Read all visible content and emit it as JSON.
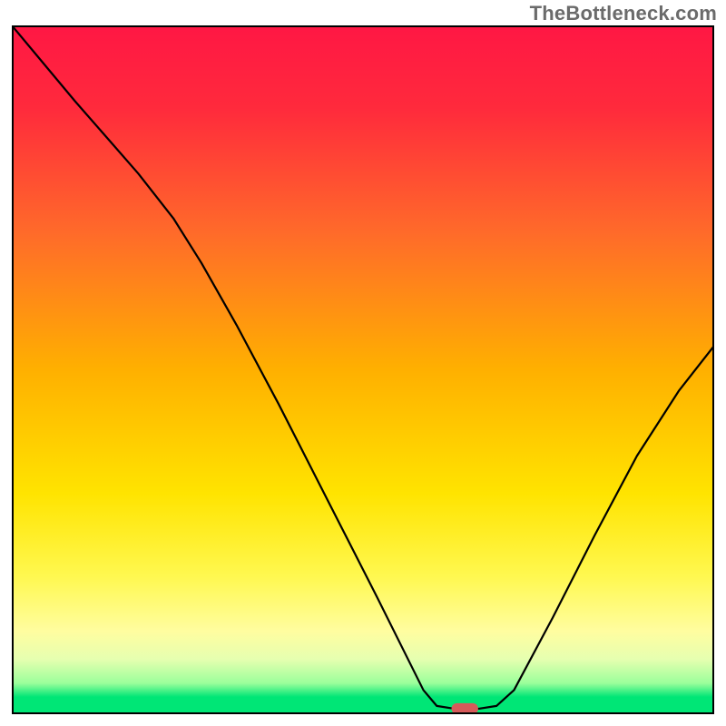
{
  "watermark": "TheBottleneck.com",
  "chart_data": {
    "type": "line",
    "title": "",
    "xlabel": "",
    "ylabel": "",
    "xlim": [
      0,
      100
    ],
    "ylim": [
      0,
      100
    ],
    "grid": false,
    "axes_visible": false,
    "gradient_stops": [
      {
        "offset": 0.0,
        "color": "#ff1744"
      },
      {
        "offset": 0.12,
        "color": "#ff2a3c"
      },
      {
        "offset": 0.3,
        "color": "#ff6a2a"
      },
      {
        "offset": 0.5,
        "color": "#ffb000"
      },
      {
        "offset": 0.68,
        "color": "#ffe400"
      },
      {
        "offset": 0.8,
        "color": "#fff850"
      },
      {
        "offset": 0.88,
        "color": "#fffda0"
      },
      {
        "offset": 0.92,
        "color": "#e6ffb0"
      },
      {
        "offset": 0.955,
        "color": "#9bff9b"
      },
      {
        "offset": 0.975,
        "color": "#00e676"
      },
      {
        "offset": 1.0,
        "color": "#00e676"
      }
    ],
    "curve_points_percent": [
      {
        "x": 0.0,
        "y": 100.0
      },
      {
        "x": 9.0,
        "y": 89.0
      },
      {
        "x": 18.0,
        "y": 78.5
      },
      {
        "x": 23.0,
        "y": 72.0
      },
      {
        "x": 27.0,
        "y": 65.5
      },
      {
        "x": 32.0,
        "y": 56.5
      },
      {
        "x": 38.0,
        "y": 45.0
      },
      {
        "x": 45.0,
        "y": 31.0
      },
      {
        "x": 52.0,
        "y": 17.0
      },
      {
        "x": 58.6,
        "y": 3.5
      },
      {
        "x": 60.5,
        "y": 1.2
      },
      {
        "x": 63.0,
        "y": 0.8
      },
      {
        "x": 66.5,
        "y": 0.8
      },
      {
        "x": 69.0,
        "y": 1.2
      },
      {
        "x": 71.5,
        "y": 3.5
      },
      {
        "x": 77.0,
        "y": 14.0
      },
      {
        "x": 83.0,
        "y": 26.0
      },
      {
        "x": 89.0,
        "y": 37.5
      },
      {
        "x": 95.0,
        "y": 47.0
      },
      {
        "x": 100.0,
        "y": 53.5
      }
    ],
    "marker": {
      "x_percent": 64.5,
      "y_percent": 0.8,
      "width_percent": 3.8,
      "height_percent": 1.6,
      "color": "#d65a5a",
      "shape": "pill"
    },
    "annotations": []
  }
}
